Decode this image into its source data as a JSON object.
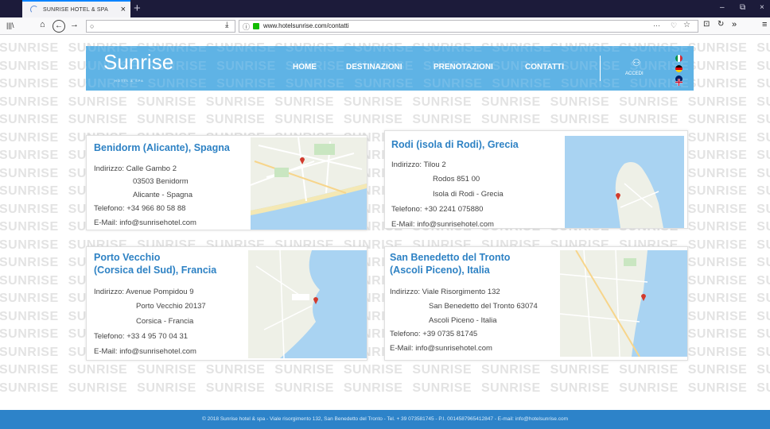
{
  "browser": {
    "tab_title": "SUNRISE HOTEL & SPA",
    "tab_close": "×",
    "new_tab": "+",
    "url": "www.hotelsunrise.com/contatti",
    "search_placeholder": "",
    "controls": {
      "minimize": "–",
      "restore": "⧉",
      "close": "×",
      "library": "|||\\",
      "home": "⌂",
      "back": "←",
      "forward": "→",
      "download": "⤓",
      "more": "···",
      "pocket": "♡",
      "star": "☆",
      "overflow": "»",
      "menu": "≡"
    }
  },
  "watermark_word": "SUNRISE",
  "header": {
    "logo": "Sunrise",
    "logo_sub": "HOTEL & SPA",
    "menu": [
      "HOME",
      "DESTINAZIONI",
      "PRENOTAZIONI",
      "CONTATTI"
    ],
    "login_label": "ACCEDI",
    "flags": [
      {
        "icon": "italy-flag-icon"
      },
      {
        "icon": "germany-flag-icon"
      },
      {
        "icon": "uk-flag-icon"
      }
    ]
  },
  "locations": [
    {
      "title": [
        "Benidorm (Alicante), Spagna"
      ],
      "address_label": "Indirizzo: Calle Gambo 2",
      "address_lines": [
        "03503 Benidorm",
        "Alicante - Spagna"
      ],
      "phone": "Telefono: +34 966 80 58 88",
      "email": "E-Mail: info@sunrisehotel.com"
    },
    {
      "title": [
        "Rodi (isola di Rodi), Grecia"
      ],
      "address_label": "Indirizzo: Tilou 2",
      "address_lines": [
        "Rodos 851 00",
        "Isola di Rodi - Grecia"
      ],
      "phone": "Telefono: +30 2241 075880",
      "email": "E-Mail: info@sunrisehotel.com"
    },
    {
      "title": [
        "Porto Vecchio",
        "(Corsica del Sud), Francia"
      ],
      "address_label": "Indirizzo: Avenue Pompidou 9",
      "address_lines": [
        "Porto Vecchio 20137",
        "Corsica - Francia"
      ],
      "phone": "Telefono: +33 4 95 70 04 31",
      "email": "E-Mail: info@sunrisehotel.com"
    },
    {
      "title": [
        "San Benedetto del Tronto",
        "(Ascoli Piceno), Italia"
      ],
      "address_label": "Indirizzo: Viale Risorgimento 132",
      "address_lines": [
        "San Benedetto del Tronto 63074",
        "Ascoli Piceno - Italia"
      ],
      "phone": "Telefono: +39 0735 81745",
      "email": "E-Mail: info@sunrisehotel.com"
    }
  ],
  "colors": {
    "header_blue": "#5fb3e5",
    "title_blue": "#2e82c4",
    "footer_blue": "#2d83c9",
    "map_water": "#a9d3f2",
    "map_land": "#eef0e7",
    "map_pin": "#d23a2d"
  },
  "footer": {
    "text": "© 2018 Sunrise hotel & spa - Viale risorgimento 132, San Benedetto del Tronto - Tel. + 39 073581745 - P.I. 0014587965412847 - E-mail: info@hotelsunrise.com"
  }
}
